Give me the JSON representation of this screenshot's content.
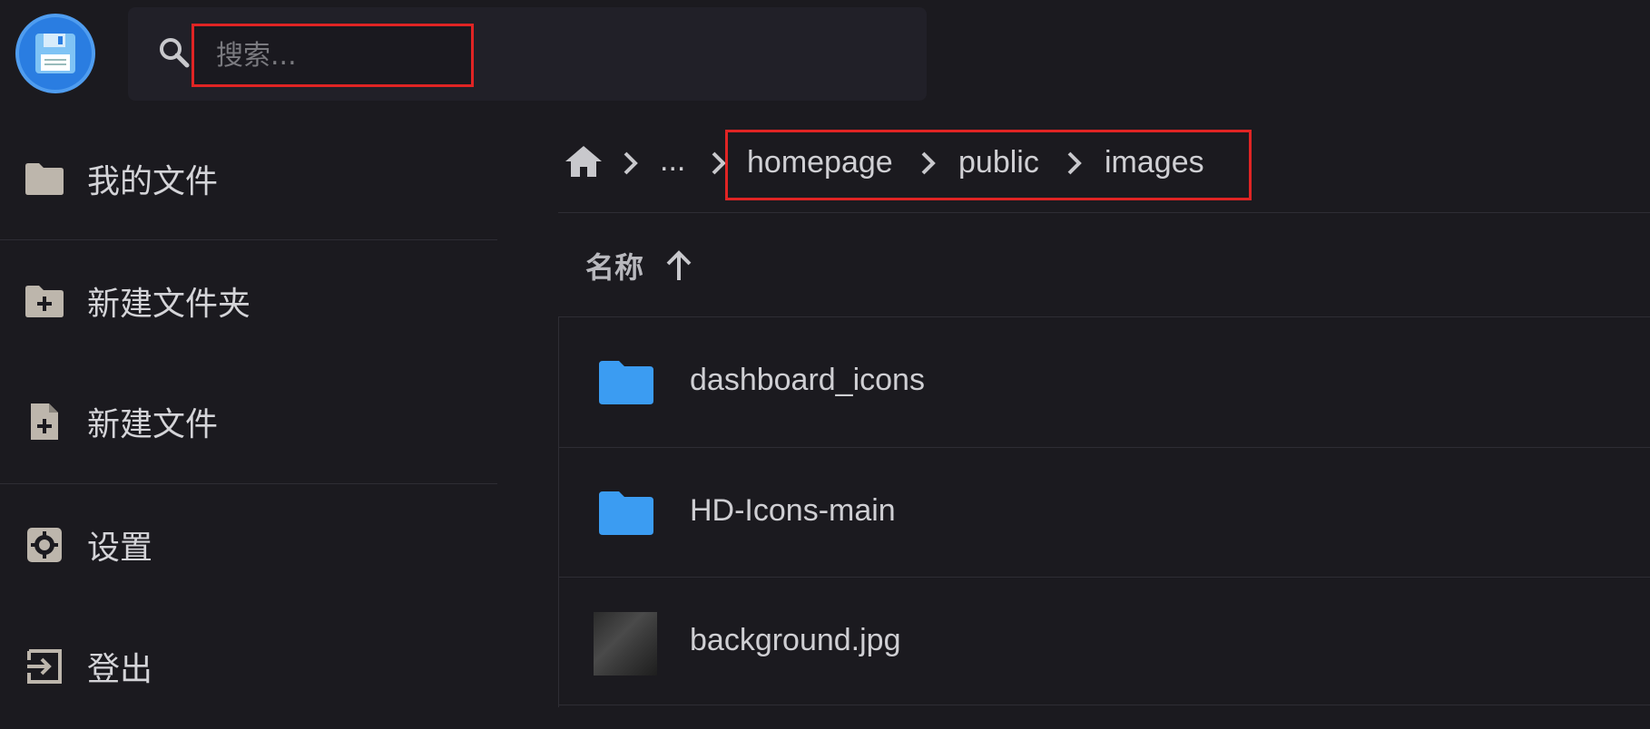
{
  "search": {
    "placeholder": "搜索..."
  },
  "sidebar": {
    "items": [
      {
        "label": "我的文件",
        "icon": "folder-icon"
      },
      {
        "label": "新建文件夹",
        "icon": "folder-plus-icon"
      },
      {
        "label": "新建文件",
        "icon": "file-plus-icon"
      },
      {
        "label": "设置",
        "icon": "gear-icon"
      },
      {
        "label": "登出",
        "icon": "logout-icon"
      }
    ]
  },
  "breadcrumb": {
    "ellipsis": "...",
    "items": [
      "homepage",
      "public",
      "images"
    ]
  },
  "listing": {
    "column_header": "名称",
    "sort": "ascending",
    "files": [
      {
        "name": "dashboard_icons",
        "type": "folder"
      },
      {
        "name": "HD-Icons-main",
        "type": "folder"
      },
      {
        "name": "background.jpg",
        "type": "image"
      }
    ]
  },
  "colors": {
    "background": "#1b1a1f",
    "accent": "#2a7de1",
    "folder": "#3b9cf2",
    "highlight": "#e02424"
  }
}
